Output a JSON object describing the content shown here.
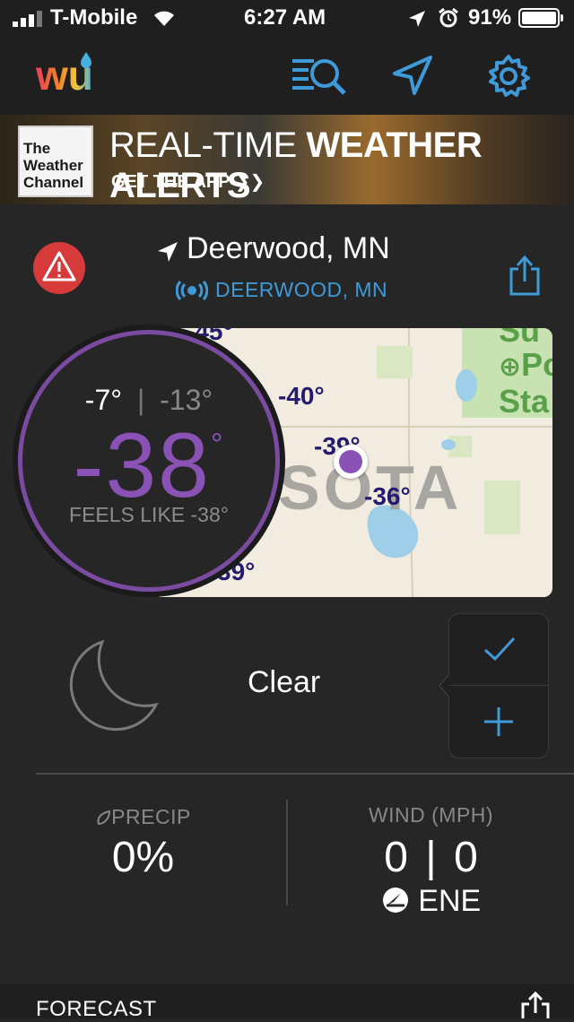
{
  "status_bar": {
    "carrier": "T-Mobile",
    "time": "6:27 AM",
    "battery": "91%"
  },
  "header": {
    "logo": "wu",
    "icons": [
      "search-list-icon",
      "location-arrow-icon",
      "gear-icon"
    ]
  },
  "ad": {
    "logo_lines": [
      "The",
      "Weather",
      "Channel"
    ],
    "title_light": "REAL-TIME",
    "title_bold": "WEATHER ALERTS",
    "cta": "GET THE APP ❯❯"
  },
  "location": {
    "name": "Deerwood, MN",
    "station": "DEERWOOD, MN"
  },
  "map": {
    "temps": [
      "-45°",
      "-40°",
      "-39°",
      "-36°",
      "39°"
    ],
    "region_label": "SOTA",
    "park_label_lines": [
      "Su",
      "Po",
      "Sta"
    ]
  },
  "current": {
    "high": "-7°",
    "low": "-13°",
    "temp": "-38",
    "degree": "°",
    "feels_like": "FEELS LIKE -38°"
  },
  "condition": {
    "text": "Clear"
  },
  "stats": {
    "precip_label": "PRECIP",
    "precip_value": "0%",
    "wind_label": "WIND (MPH)",
    "wind_speed": "0",
    "wind_gust": "0",
    "wind_dir": "ENE"
  },
  "forecast": {
    "label": "FORECAST"
  },
  "colors": {
    "accent_blue": "#3e9ad8",
    "temp_purple": "#8a52b5",
    "alert_red": "#d63a3a"
  }
}
